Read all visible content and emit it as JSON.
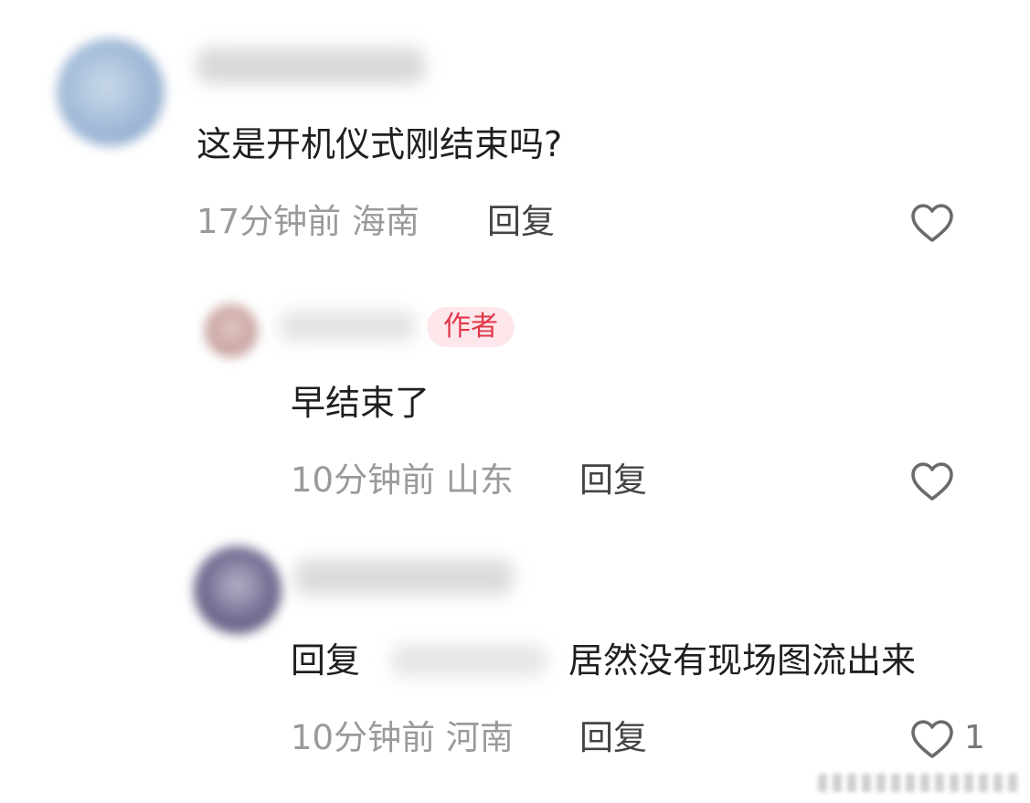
{
  "comments": [
    {
      "text": "这是开机仪式刚结束吗?",
      "time": "17分钟前",
      "location": "海南",
      "reply_label": "回复",
      "likes": "",
      "avatar_color": "#9fb8d6"
    },
    {
      "badge": "作者",
      "text": "早结束了",
      "time": "10分钟前",
      "location": "山东",
      "reply_label": "回复",
      "likes": "",
      "avatar_color": "#c8a3a0"
    },
    {
      "reply_prefix": "回复",
      "text": "居然没有现场图流出来",
      "time": "10分钟前",
      "location": "河南",
      "reply_label": "回复",
      "likes": "1",
      "avatar_color": "#6f6a8f"
    }
  ],
  "colors": {
    "badge_bg": "#fde7ea",
    "badge_text": "#e0374a",
    "meta": "#9a9a9a",
    "heart": "#6b6b6b"
  }
}
